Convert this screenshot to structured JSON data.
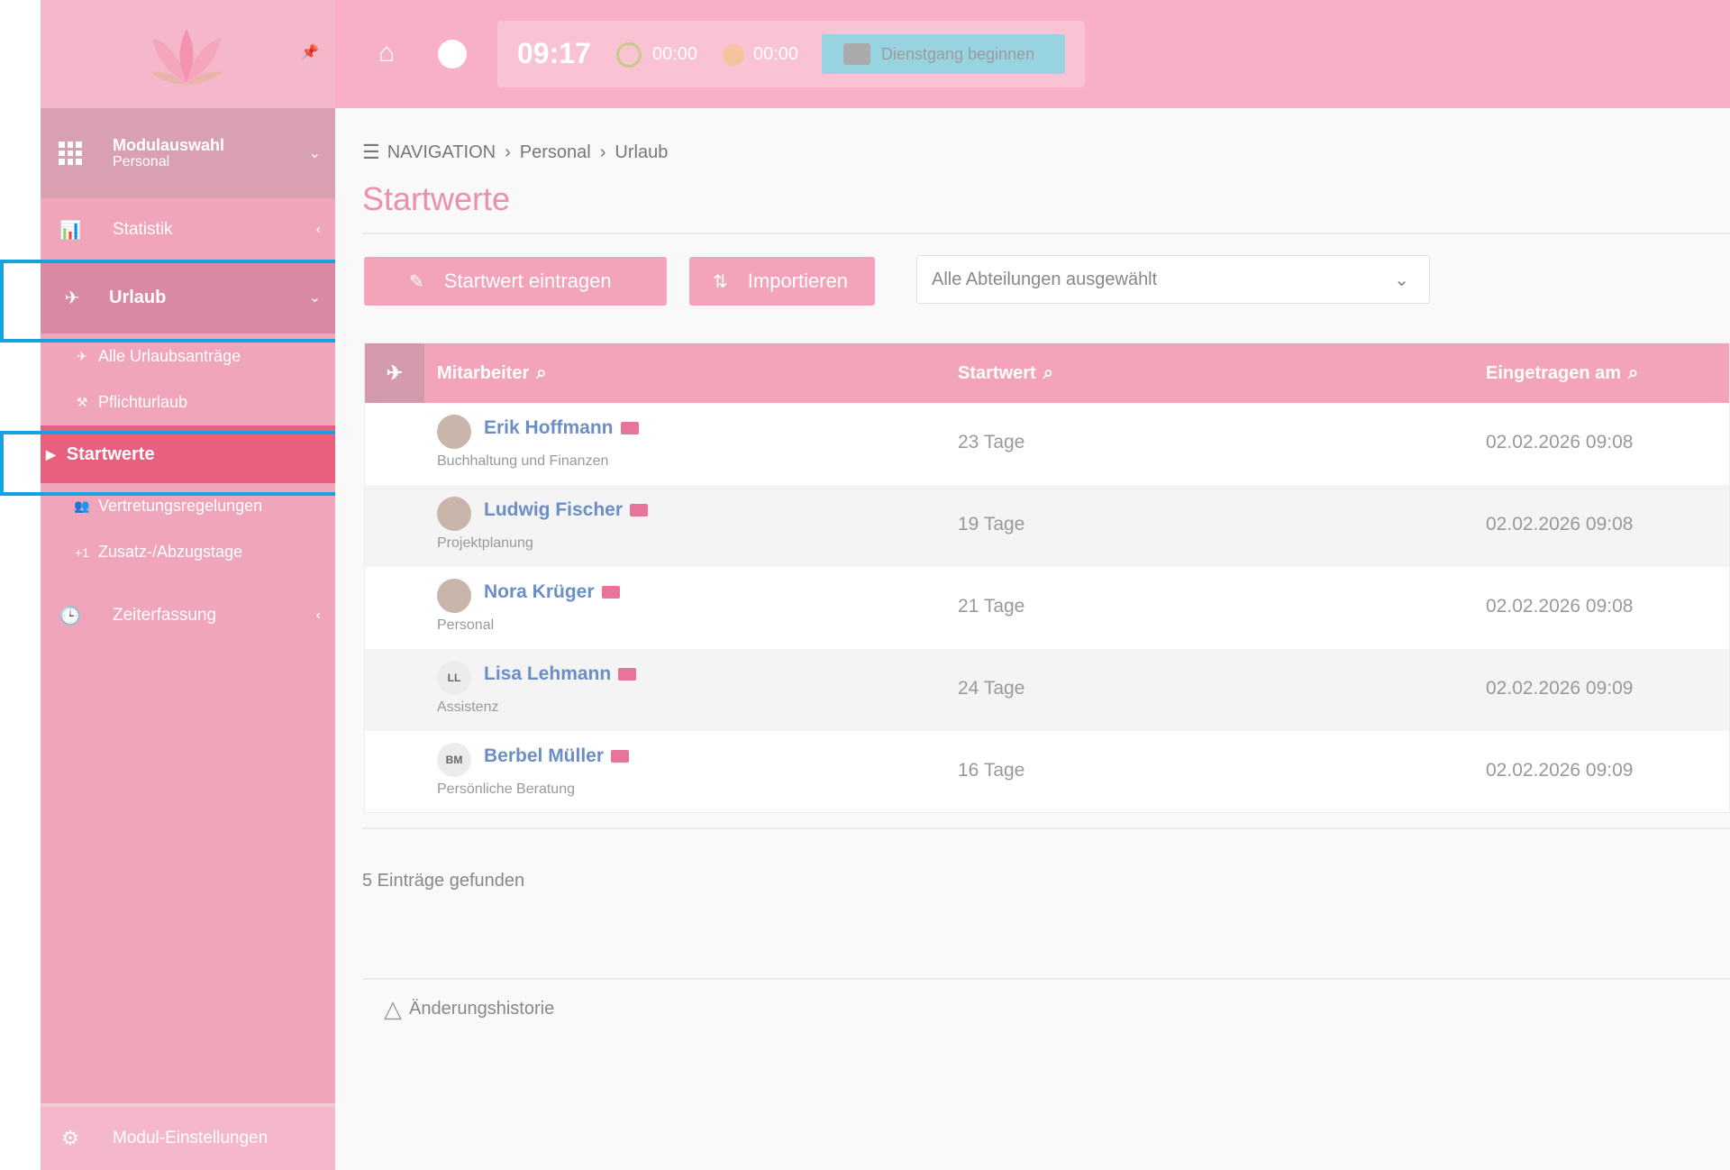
{
  "header": {
    "time": "09:17",
    "timer1": "00:00",
    "timer2": "00:00",
    "dienstgang_label": "Dienstgang beginnen"
  },
  "sidebar": {
    "modul_title": "Modulauswahl",
    "modul_sub": "Personal",
    "statistik": "Statistik",
    "urlaub": "Urlaub",
    "sub_items": [
      {
        "label": "Alle Urlaubsanträge"
      },
      {
        "label": "Pflichturlaub"
      },
      {
        "label": "Startwerte"
      },
      {
        "label": "Vertretungsregelungen"
      },
      {
        "label": "Zusatz-/Abzugstage"
      }
    ],
    "zeiterfassung": "Zeiterfassung",
    "settings": "Modul-Einstellungen"
  },
  "breadcrumb": {
    "nav": "NAVIGATION",
    "personal": "Personal",
    "urlaub": "Urlaub"
  },
  "page_title": "Startwerte",
  "toolbar": {
    "add_label": "Startwert eintragen",
    "import_label": "Importieren",
    "department_select": "Alle Abteilungen ausgewählt"
  },
  "table": {
    "headers": {
      "employee": "Mitarbeiter",
      "start_value": "Startwert",
      "entered_at": "Eingetragen am"
    },
    "rows": [
      {
        "name": "Erik Hoffmann",
        "department": "Buchhaltung und Finanzen",
        "value": "23 Tage",
        "date": "02.02.2026 09:08",
        "initials": ""
      },
      {
        "name": "Ludwig Fischer",
        "department": "Projektplanung",
        "value": "19 Tage",
        "date": "02.02.2026 09:08",
        "initials": ""
      },
      {
        "name": "Nora Krüger",
        "department": "Personal",
        "value": "21 Tage",
        "date": "02.02.2026 09:08",
        "initials": ""
      },
      {
        "name": "Lisa Lehmann",
        "department": "Assistenz",
        "value": "24 Tage",
        "date": "02.02.2026 09:09",
        "initials": "LL"
      },
      {
        "name": "Berbel Müller",
        "department": "Persönliche Beratung",
        "value": "16 Tage",
        "date": "02.02.2026 09:09",
        "initials": "BM"
      }
    ]
  },
  "entries_found": "5 Einträge gefunden",
  "history": "Änderungshistorie",
  "colors": {
    "accent": "#e8607e",
    "highlight": "#14a3e0"
  }
}
